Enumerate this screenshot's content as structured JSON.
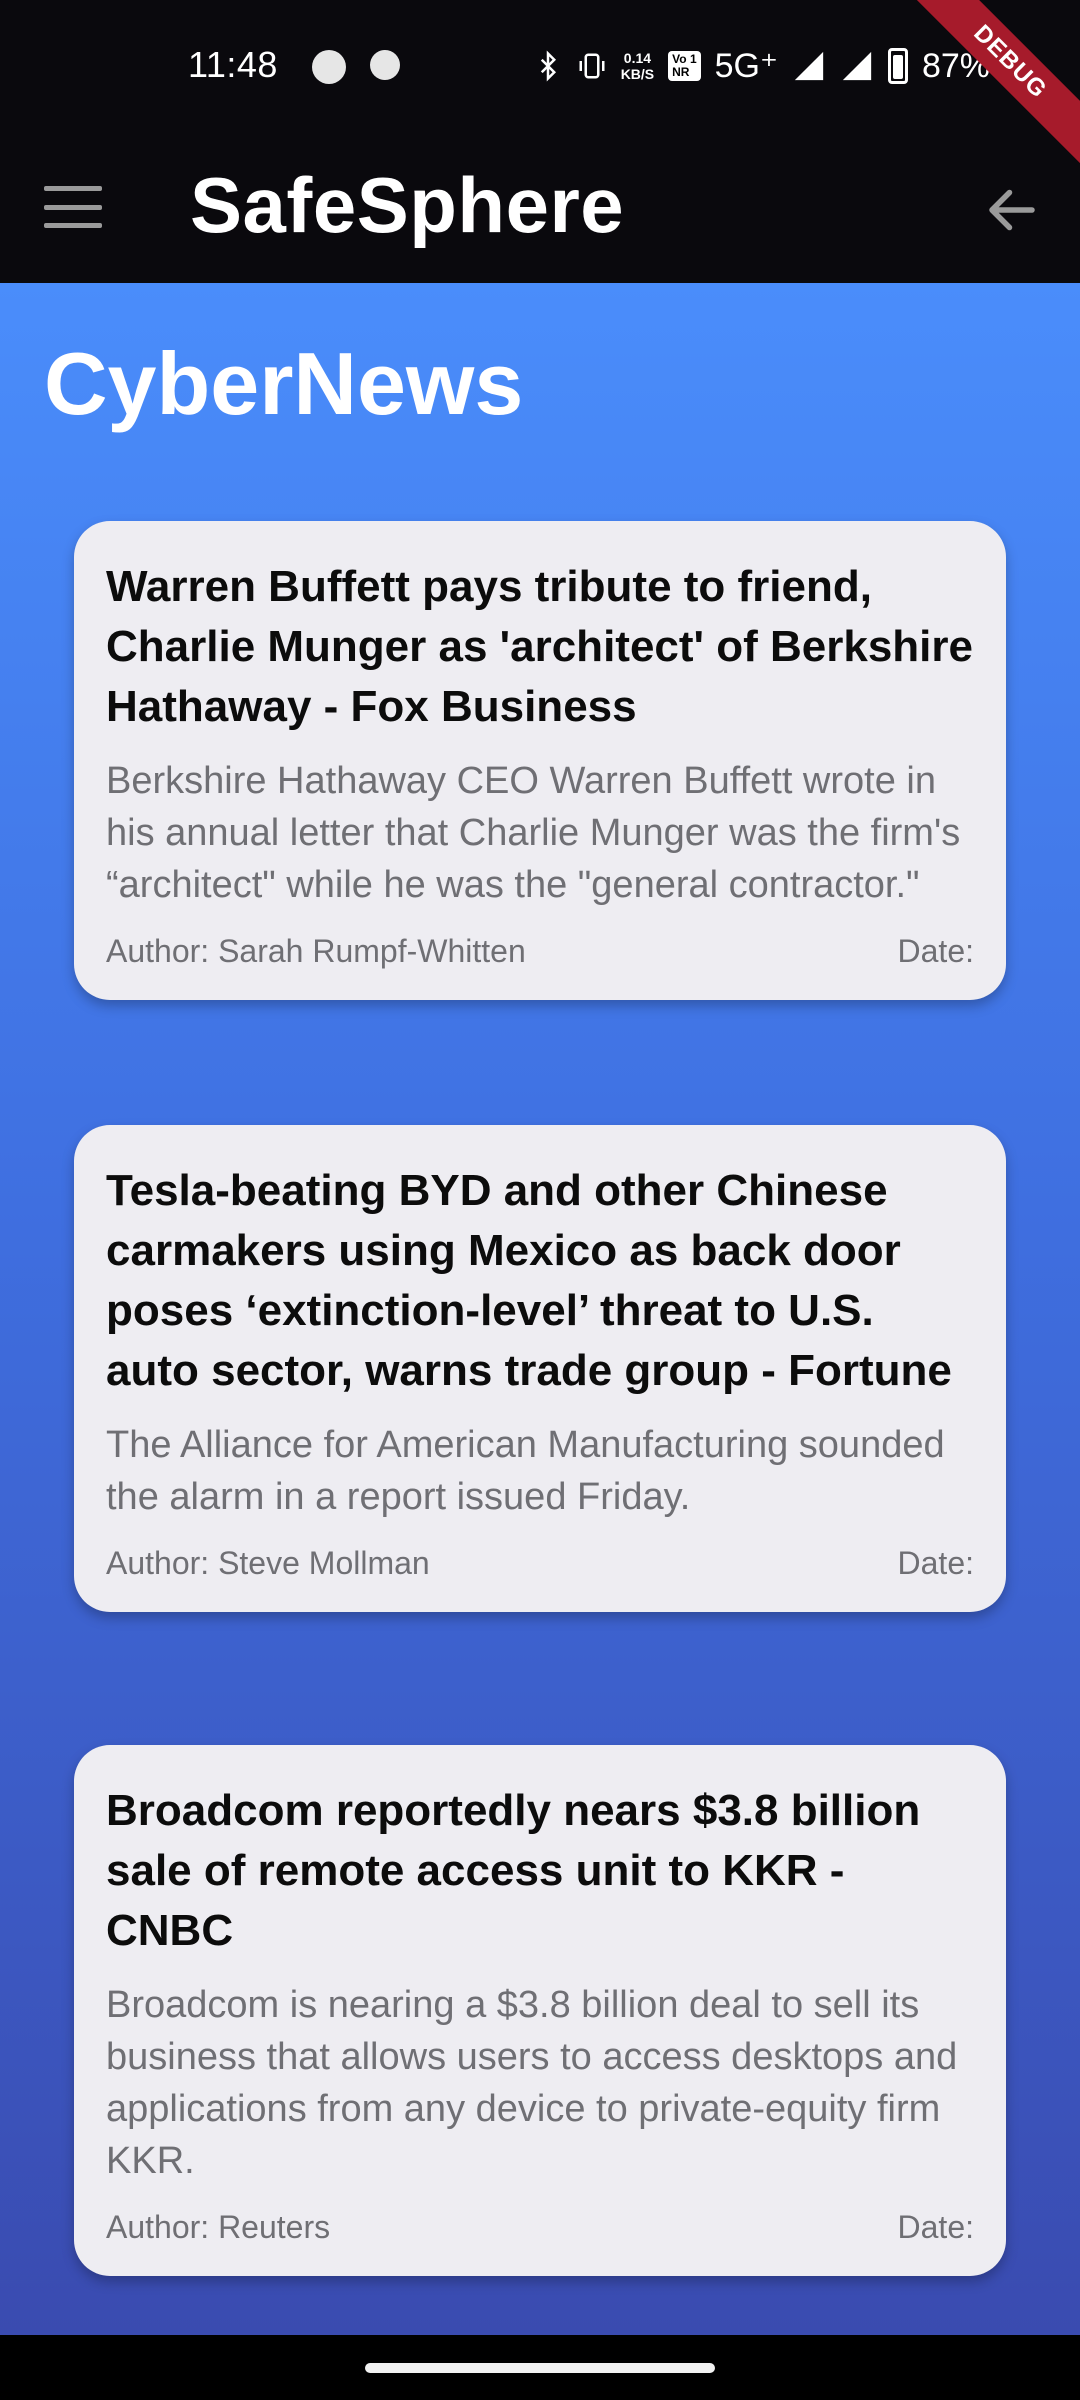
{
  "status_bar": {
    "time": "11:48",
    "net_speed_value": "0.14",
    "net_speed_unit": "KB/S",
    "vonr_top": "Vo",
    "vonr_num": "1",
    "vonr_bottom": "NR",
    "network": "5G⁺",
    "battery": "87%",
    "icons": [
      "app-icon",
      "notification-icon",
      "bluetooth-icon",
      "vibrate-icon",
      "signal-icon",
      "signal-icon",
      "battery-icon"
    ]
  },
  "debug_banner": "DEBUG",
  "app_bar": {
    "title": "SafeSphere",
    "menu_icon": "hamburger-menu-icon",
    "back_icon": "arrow-back-icon"
  },
  "page": {
    "title": "CyberNews"
  },
  "articles": [
    {
      "title": "Warren Buffett pays tribute to friend, Charlie Munger as 'architect' of Berkshire Hathaway - Fox Business",
      "description": "Berkshire Hathaway CEO Warren Buffett wrote in his annual letter that Charlie Munger was the firm's “architect\" while he was the \"general contractor.\"",
      "author": "Author: Sarah Rumpf-Whitten",
      "date": "Date:"
    },
    {
      "title": "Tesla-beating BYD and other Chinese carmakers using Mexico as back door poses ‘extinction-level’ threat to U.S. auto sector, warns trade group - Fortune",
      "description": "The Alliance for American Manufacturing sounded the alarm in a report issued Friday.",
      "author": "Author: Steve Mollman",
      "date": "Date:"
    },
    {
      "title": "Broadcom reportedly nears $3.8 billion sale of remote access unit to KKR - CNBC",
      "description": "Broadcom is nearing a $3.8 billion deal to sell its business that allows users to access desktops and applications from any device to private-equity firm KKR.",
      "author": "Author: Reuters",
      "date": "Date:"
    }
  ],
  "colors": {
    "gradient_top": "#4a8dfb",
    "gradient_bottom": "#3a4bb0",
    "card_bg": "#eeedf2",
    "appbar_bg": "#0a090d",
    "debug_red": "#a61b2b"
  }
}
